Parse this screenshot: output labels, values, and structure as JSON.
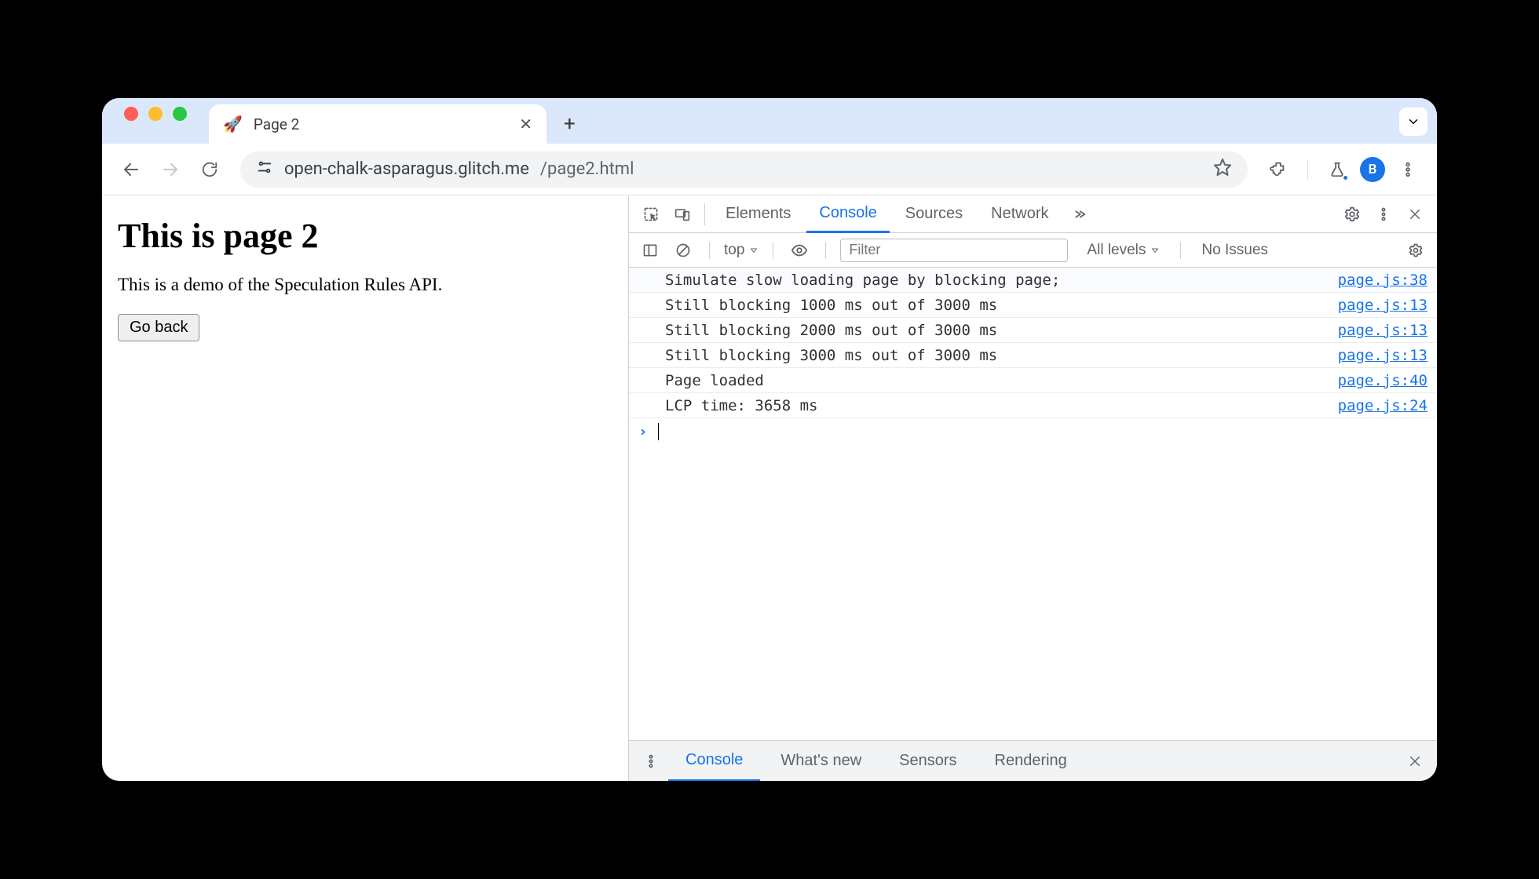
{
  "window": {
    "tab_title": "Page 2",
    "favicon": "🚀"
  },
  "toolbar": {
    "url_host": "open-chalk-asparagus.glitch.me",
    "url_path": "/page2.html",
    "avatar_letter": "B"
  },
  "page": {
    "heading": "This is page 2",
    "paragraph": "This is a demo of the Speculation Rules API.",
    "back_button": "Go back"
  },
  "devtools": {
    "tabs": [
      "Elements",
      "Console",
      "Sources",
      "Network"
    ],
    "active_tab": "Console",
    "console_toolbar": {
      "context": "top",
      "filter_placeholder": "Filter",
      "levels": "All levels",
      "issues": "No Issues"
    },
    "logs": [
      {
        "msg": "Simulate slow loading page by blocking page;",
        "src": "page.js:38"
      },
      {
        "msg": "Still blocking 1000 ms out of 3000 ms",
        "src": "page.js:13"
      },
      {
        "msg": "Still blocking 2000 ms out of 3000 ms",
        "src": "page.js:13"
      },
      {
        "msg": "Still blocking 3000 ms out of 3000 ms",
        "src": "page.js:13"
      },
      {
        "msg": "Page loaded",
        "src": "page.js:40"
      },
      {
        "msg": "LCP time: 3658 ms",
        "src": "page.js:24"
      }
    ],
    "drawer": [
      "Console",
      "What's new",
      "Sensors",
      "Rendering"
    ],
    "drawer_active": "Console"
  }
}
